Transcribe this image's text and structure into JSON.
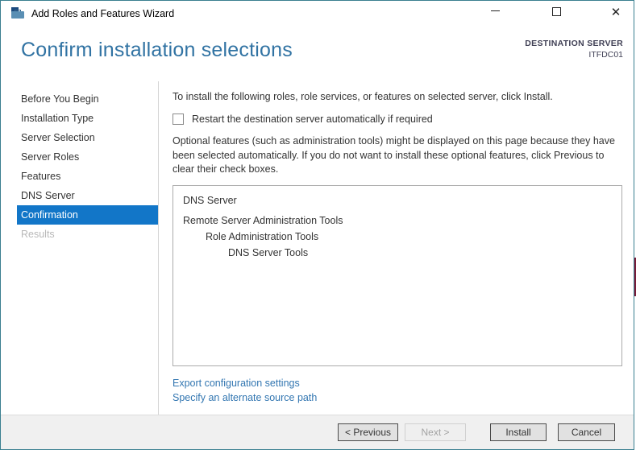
{
  "window": {
    "title": "Add Roles and Features Wizard",
    "controls": {
      "minimize": "minimize",
      "maximize": "maximize",
      "close": "close"
    }
  },
  "header": {
    "title": "Confirm installation selections",
    "destination_label": "DESTINATION SERVER",
    "destination_server": "ITFDC01"
  },
  "sidebar": {
    "items": [
      {
        "label": "Before You Begin",
        "selected": false,
        "disabled": false
      },
      {
        "label": "Installation Type",
        "selected": false,
        "disabled": false
      },
      {
        "label": "Server Selection",
        "selected": false,
        "disabled": false
      },
      {
        "label": "Server Roles",
        "selected": false,
        "disabled": false
      },
      {
        "label": "Features",
        "selected": false,
        "disabled": false
      },
      {
        "label": "DNS Server",
        "selected": false,
        "disabled": false
      },
      {
        "label": "Confirmation",
        "selected": true,
        "disabled": false
      },
      {
        "label": "Results",
        "selected": false,
        "disabled": true
      }
    ]
  },
  "main": {
    "intro": "To install the following roles, role services, or features on selected server, click Install.",
    "restart_checkbox_label": "Restart the destination server automatically if required",
    "restart_checkbox_checked": false,
    "optional_note": "Optional features (such as administration tools) might be displayed on this page because they have been selected automatically. If you do not want to install these optional features, click Previous to clear their check boxes.",
    "selection_list": [
      {
        "text": "DNS Server",
        "indent": 0
      },
      {
        "text": "Remote Server Administration Tools",
        "indent": 0
      },
      {
        "text": "Role Administration Tools",
        "indent": 1
      },
      {
        "text": "DNS Server Tools",
        "indent": 2
      }
    ],
    "links": [
      "Export configuration settings",
      "Specify an alternate source path"
    ]
  },
  "footer": {
    "previous_label": "< Previous",
    "next_label": "Next >",
    "next_disabled": true,
    "install_label": "Install",
    "cancel_label": "Cancel"
  },
  "colors": {
    "header_text": "#3173a3",
    "nav_selected_bg": "#1276c8",
    "link": "#3276b1",
    "dialog_border": "#3a7f90",
    "background_accent": "#7a1b38",
    "footer_bg": "#f0f0f0"
  }
}
